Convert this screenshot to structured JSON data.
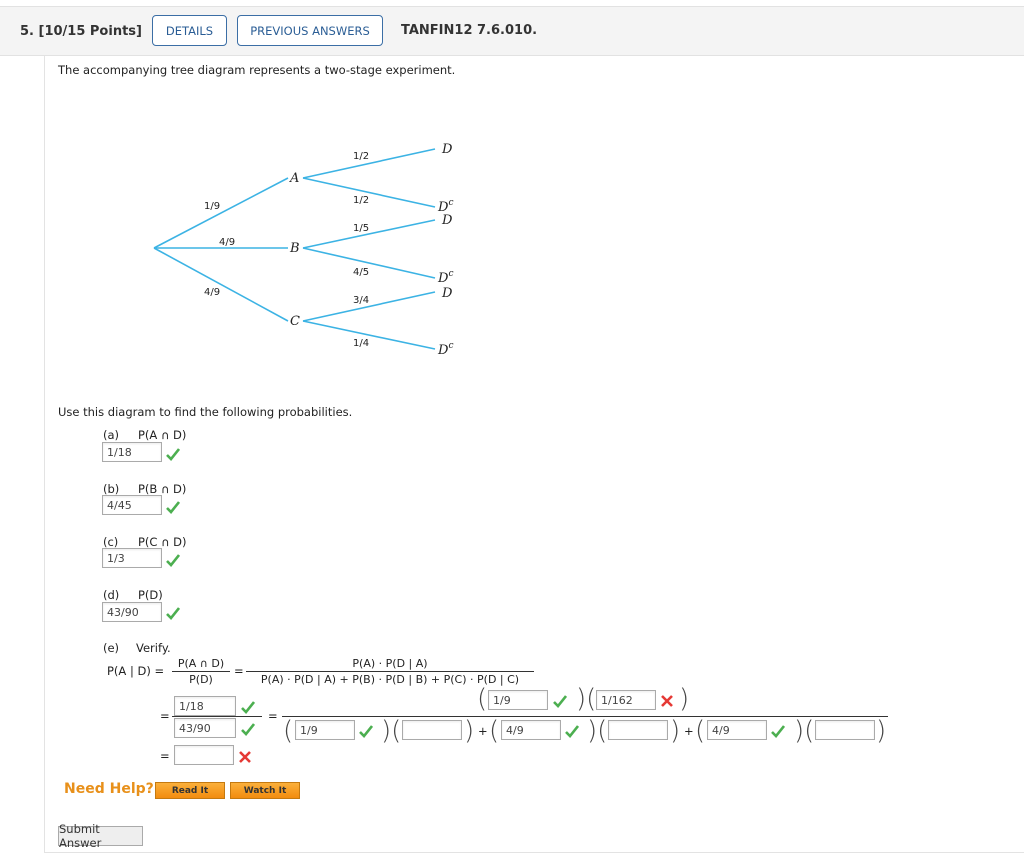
{
  "header": {
    "question_number": "5. [10/15 Points]",
    "details_label": "DETAILS",
    "previous_answers_label": "PREVIOUS ANSWERS",
    "question_id": "TANFIN12 7.6.010."
  },
  "statement": "The accompanying tree diagram represents a two-stage experiment.",
  "tree": {
    "stage1": [
      {
        "node": "A",
        "prob": "1/9"
      },
      {
        "node": "B",
        "prob": "4/9"
      },
      {
        "node": "C",
        "prob": "4/9"
      }
    ],
    "stage2": {
      "A": [
        {
          "node": "D",
          "prob": "1/2"
        },
        {
          "node": "D",
          "sup": "c",
          "prob": "1/2"
        }
      ],
      "B": [
        {
          "node": "D",
          "prob": "1/5"
        },
        {
          "node": "D",
          "sup": "c",
          "prob": "4/5"
        }
      ],
      "C": [
        {
          "node": "D",
          "prob": "3/4"
        },
        {
          "node": "D",
          "sup": "c",
          "prob": "1/4"
        }
      ]
    },
    "line_color": "#3cb3e4"
  },
  "instruction": "Use this diagram to find the following probabilities.",
  "parts": {
    "a": {
      "label": "(a)",
      "expr": "P(A ∩ D)",
      "answer": "1/18",
      "status": "correct"
    },
    "b": {
      "label": "(b)",
      "expr": "P(B ∩ D)",
      "answer": "4/45",
      "status": "correct"
    },
    "c": {
      "label": "(c)",
      "expr": "P(C ∩ D)",
      "answer": "1/3",
      "status": "correct"
    },
    "d": {
      "label": "(d)",
      "expr": "P(D)",
      "answer": "43/90",
      "status": "correct"
    },
    "e": {
      "label": "(e)",
      "verify": "Verify.",
      "lhs": "P(A | D) =",
      "frac1_num": "P(A ∩ D)",
      "frac1_den": "P(D)",
      "eq": "=",
      "frac2_num": "P(A) · P(D | A)",
      "frac2_den": "P(A) · P(D | A) + P(B) · P(D | B) + P(C) · P(D | C)",
      "num_input": "1/18",
      "den_input": "43/90",
      "rhs_num_pa": "1/9",
      "rhs_num_pda": "1/162",
      "rhs_den_pa": "1/9",
      "rhs_den_pda": "",
      "rhs_den_pb": "4/9",
      "rhs_den_pdb": "",
      "rhs_den_pc": "4/9",
      "rhs_den_pdc": "",
      "plus": "+",
      "final_input": ""
    }
  },
  "help": {
    "need_help": "Need Help?",
    "read_it": "Read It",
    "watch_it": "Watch It"
  },
  "submit_label": "Submit Answer",
  "colors": {
    "correct": "#4caf50",
    "incorrect": "#e53935",
    "accent": "#2a5d95",
    "help": "#e8901a"
  }
}
